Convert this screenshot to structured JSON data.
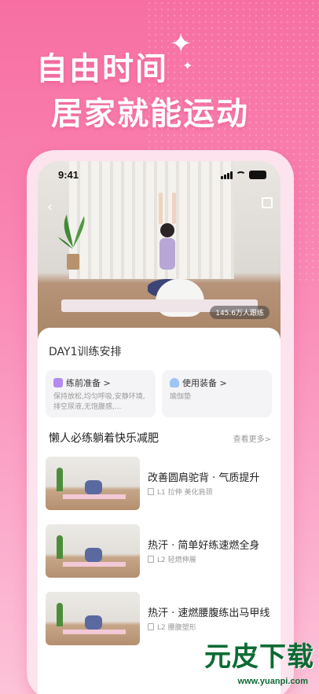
{
  "hero": {
    "line1": "自由时间",
    "line2": "居家就能运动"
  },
  "status_bar": {
    "time": "9:41"
  },
  "video": {
    "viewers": "145.6万人跟练"
  },
  "plan": {
    "title": "DAY1训练安排",
    "prep": {
      "label": "练前准备 >",
      "desc": "保持放松,均匀呼吸,安静环境,排空尿液,无饱腹感,..."
    },
    "equipment": {
      "label": "使用装备 >",
      "desc": "瑜伽垫"
    }
  },
  "section": {
    "title": "懒人必练躺着快乐减肥",
    "more": "查看更多>"
  },
  "courses": [
    {
      "title": "改善圆肩驼背 · 气质提升",
      "meta": "L1 拉伸  美化肩颈"
    },
    {
      "title": "热汗 · 简单好练速燃全身",
      "meta": "L2 轻燃伸展"
    },
    {
      "title": "热汗 · 速燃腰腹练出马甲线",
      "meta": "L2 腰腹塑形"
    }
  ],
  "watermark": {
    "brand": "元皮下载",
    "url": "www.yuanpi.com"
  },
  "colors": {
    "accent": "#f76fa2",
    "highlight": "#f8a9c4",
    "watermark": "#0c6b33"
  }
}
